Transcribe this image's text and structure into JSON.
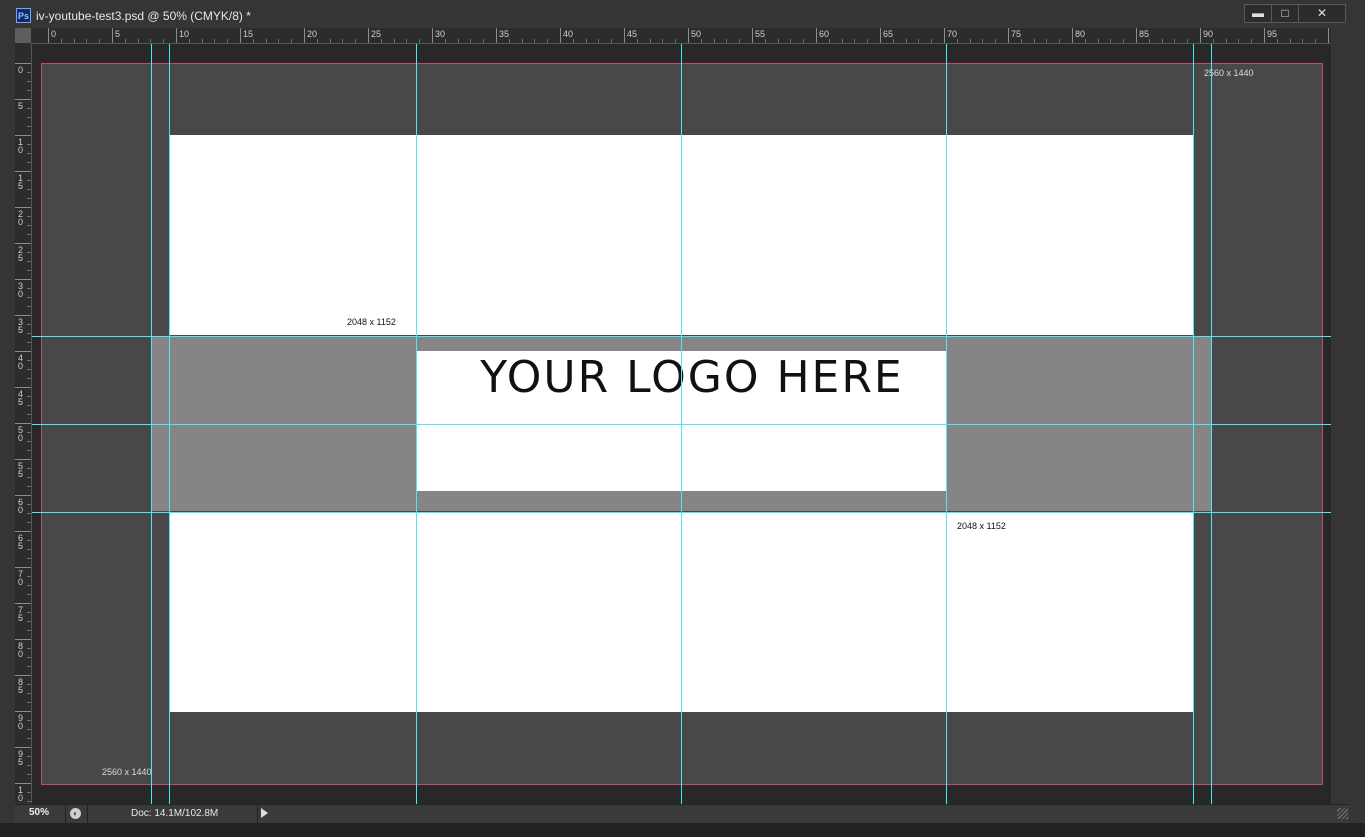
{
  "window": {
    "app_icon": "Ps",
    "title": "iv-youtube-test3.psd @ 50% (CMYK/8) *",
    "controls": {
      "minimize": "▬",
      "maximize": "□",
      "close": "✕"
    }
  },
  "rulers": {
    "horizontal_labels": [
      "0",
      "5",
      "10",
      "15",
      "20",
      "25",
      "30",
      "35",
      "40",
      "45",
      "50",
      "55",
      "60",
      "65",
      "70",
      "75",
      "80",
      "85",
      "90",
      "95",
      "10"
    ],
    "vertical_labels": [
      "0",
      "5",
      "10",
      "15",
      "20",
      "25",
      "30",
      "35",
      "40",
      "45",
      "50",
      "55",
      "60",
      "65",
      "70",
      "75",
      "80",
      "85",
      "90",
      "95",
      "10"
    ]
  },
  "document": {
    "logo_text": "YOUR LOGO HERE",
    "label_top_right": "2560 x 1440",
    "label_bottom_left": "2560 x 1440",
    "label_upper_safe": "2048 x 1152",
    "label_lower_safe": "2048 x 1152"
  },
  "status_bar": {
    "zoom": "50%",
    "doc_size": "Doc: 14.1M/102.8M"
  }
}
